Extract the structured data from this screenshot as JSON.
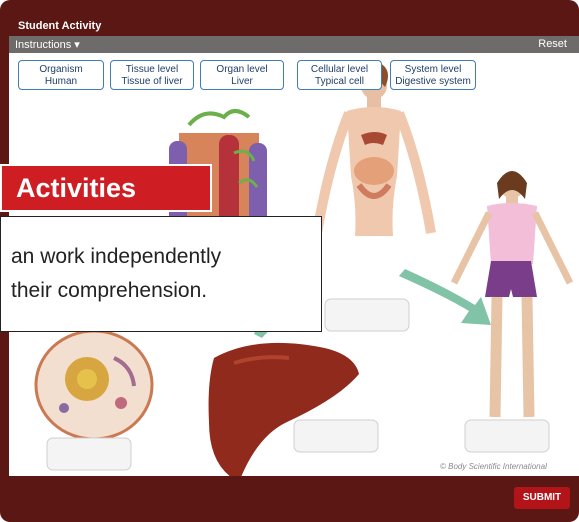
{
  "window": {
    "title": "Student Activity"
  },
  "toolbar": {
    "instructions": "Instructions ▾",
    "reset": "Reset"
  },
  "chips": [
    {
      "title": "Organism",
      "sub": "Human"
    },
    {
      "title": "Tissue level",
      "sub": "Tissue of liver"
    },
    {
      "title": "Organ level",
      "sub": "Liver"
    },
    {
      "title": "Cellular level",
      "sub": "Typical cell"
    },
    {
      "title": "System level",
      "sub": "Digestive system"
    }
  ],
  "overlay": {
    "banner": "Activities",
    "line1": "an work independently",
    "line2": "their comprehension."
  },
  "credit": "© Body Scientific International",
  "submit": "SUBMIT",
  "colors": {
    "frame": "#5b1714",
    "banner": "#ce1e23",
    "chip_border": "#3f7db3",
    "submit": "#b3141a"
  }
}
